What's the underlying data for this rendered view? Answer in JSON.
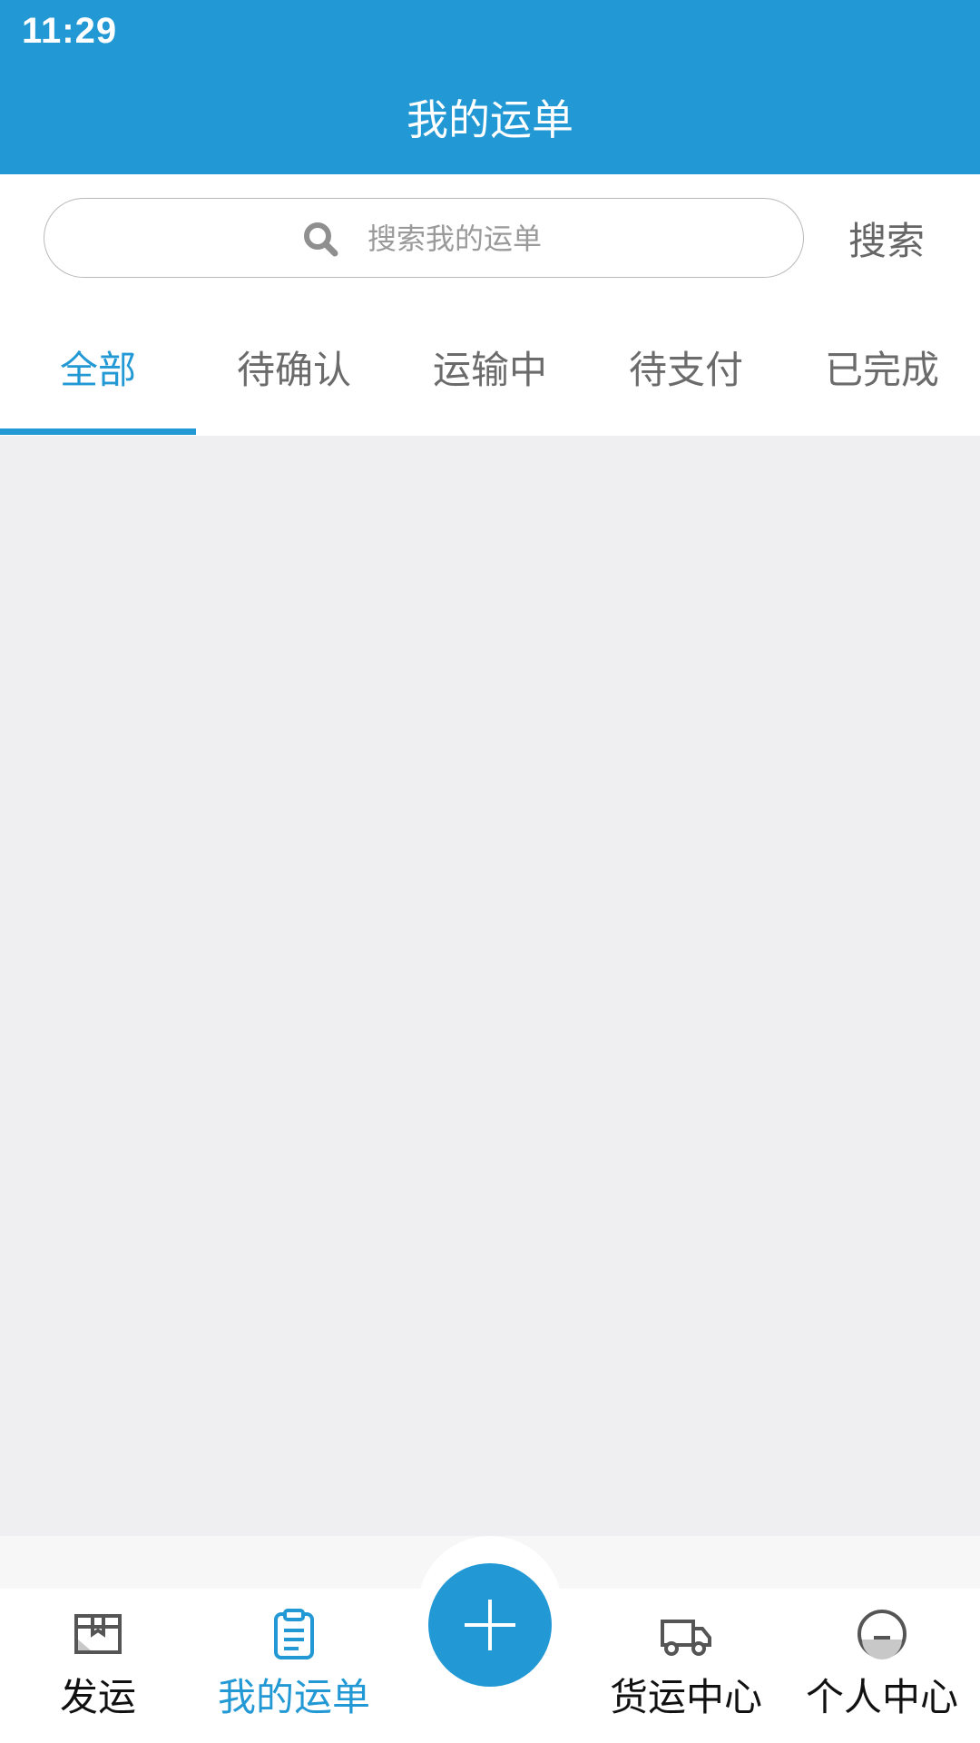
{
  "status_bar": {
    "time": "11:29"
  },
  "header": {
    "title": "我的运单"
  },
  "search": {
    "placeholder": "搜索我的运单",
    "button_label": "搜索"
  },
  "tabs": [
    {
      "label": "全部",
      "active": true
    },
    {
      "label": "待确认",
      "active": false
    },
    {
      "label": "运输中",
      "active": false
    },
    {
      "label": "待支付",
      "active": false
    },
    {
      "label": "已完成",
      "active": false
    }
  ],
  "bottom_nav": {
    "items": [
      {
        "label": "发运",
        "icon": "package-icon",
        "active": false
      },
      {
        "label": "我的运单",
        "icon": "clipboard-icon",
        "active": true
      },
      {
        "label": "货运中心",
        "icon": "truck-icon",
        "active": false
      },
      {
        "label": "个人中心",
        "icon": "profile-icon",
        "active": false
      }
    ],
    "fab_icon": "plus-icon"
  },
  "colors": {
    "primary": "#2299d4",
    "background": "#efeef1",
    "text_dark": "#111111",
    "text_muted": "#6b6b6b"
  }
}
